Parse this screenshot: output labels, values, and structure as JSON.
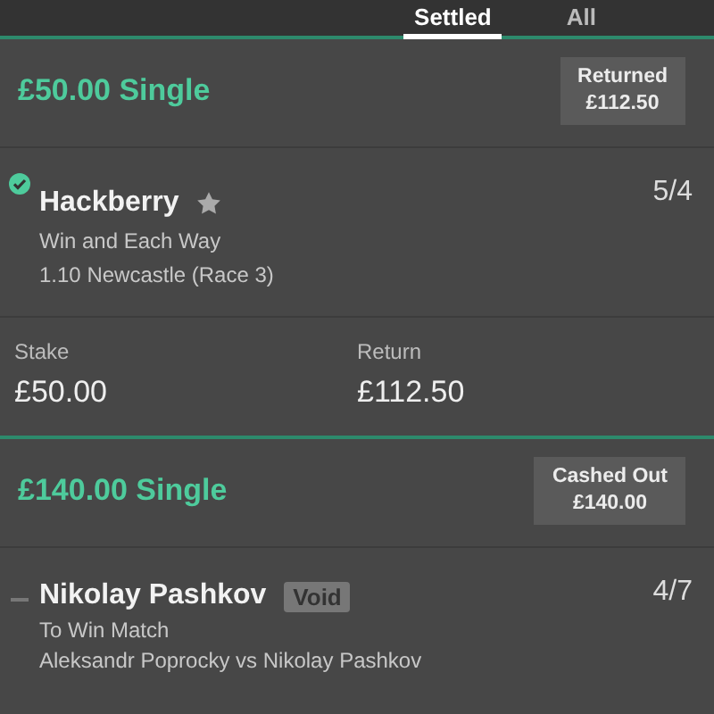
{
  "tabs": [
    {
      "label": "Settled",
      "selected": true
    },
    {
      "label": "All",
      "selected": false
    }
  ],
  "bets": [
    {
      "title": "£50.00 Single",
      "status_label": "Returned",
      "status_amount": "£112.50",
      "selection": {
        "kind": "won",
        "name": "Hackberry",
        "starred": true,
        "odds": "5/4",
        "lines": [
          "Win and Each Way",
          "1.10 Newcastle (Race 3)"
        ]
      },
      "stake_label": "Stake",
      "stake": "£50.00",
      "return_label": "Return",
      "return": "£112.50"
    },
    {
      "title": "£140.00 Single",
      "status_label": "Cashed Out",
      "status_amount": "£140.00",
      "selection": {
        "kind": "void",
        "name": "Nikolay Pashkov",
        "badge": "Void",
        "odds": "4/7",
        "lines": [
          "To Win Match",
          "Aleksandr Poprocky vs Nikolay Pashkov"
        ]
      }
    }
  ]
}
